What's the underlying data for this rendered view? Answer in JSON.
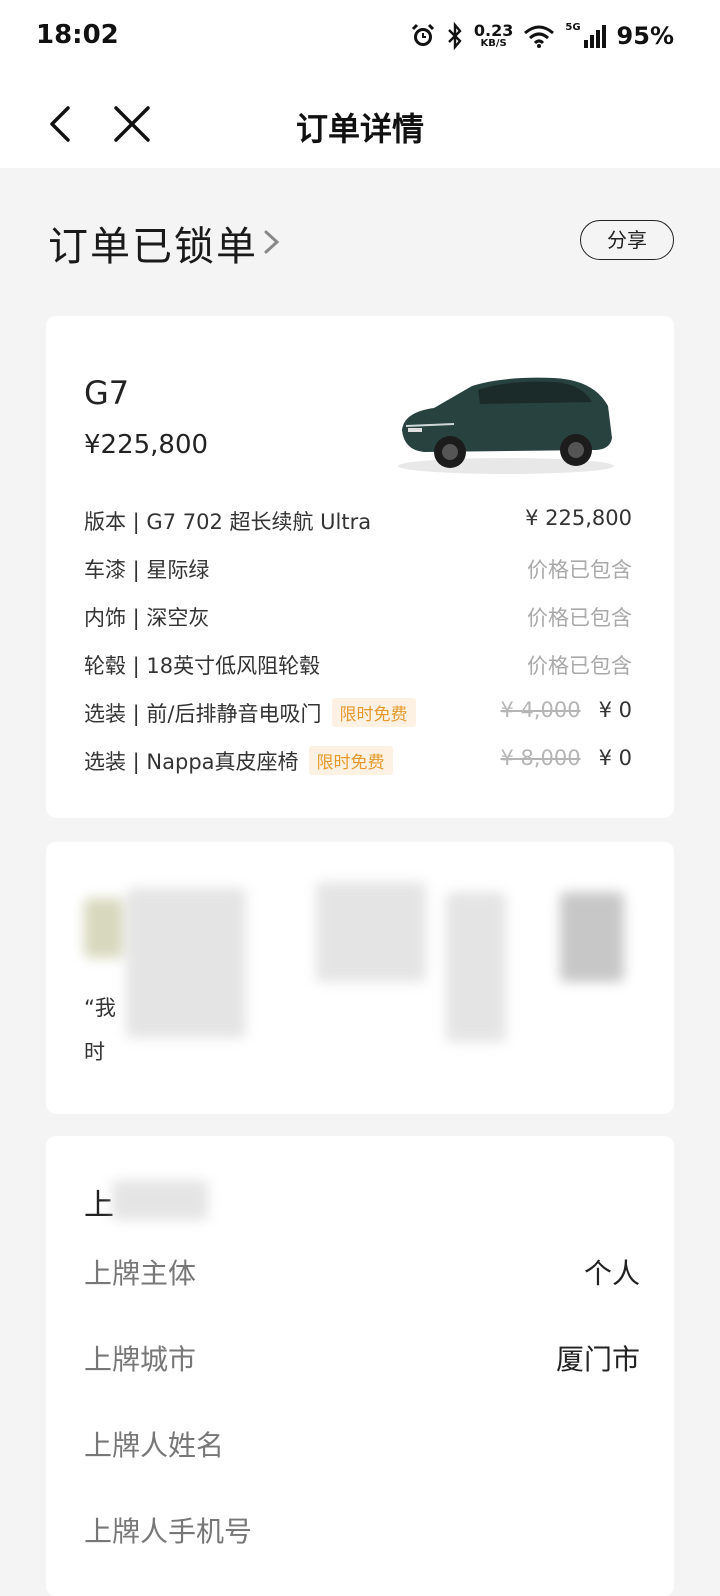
{
  "status_bar": {
    "time": "18:02",
    "net_speed_value": "0.23",
    "net_speed_unit": "KB/S",
    "network": "5G",
    "battery": "95%",
    "icons": [
      "alarm-icon",
      "bluetooth-icon",
      "wifi-icon",
      "signal-icon"
    ]
  },
  "nav": {
    "title": "订单详情",
    "back_icon": "chevron-left-icon",
    "close_icon": "close-icon"
  },
  "order_status": {
    "title": "订单已锁单",
    "share_label": "分享"
  },
  "car": {
    "model": "G7",
    "price": "¥225,800",
    "color_hex": "#27423f"
  },
  "config_rows": [
    {
      "label": "版本 | G7 702 超长续航 Ultra",
      "value": "¥ 225,800"
    },
    {
      "label": "车漆 | 星际绿",
      "value": "价格已包含"
    },
    {
      "label": "内饰 | 深空灰",
      "value": "价格已包含"
    },
    {
      "label": "轮毂 | 18英寸低风阻轮毂",
      "value": "价格已包含"
    },
    {
      "label": "选装 | 前/后排静音电吸门",
      "tag": "限时免费",
      "old_price": "¥ 4,000",
      "value": "¥ 0"
    },
    {
      "label": "选装 | Nappa真皮座椅",
      "tag": "限时免费",
      "old_price": "¥ 8,000",
      "value": "¥ 0"
    }
  ],
  "blurred_card": {
    "line1": "“我",
    "line2": "时"
  },
  "plate_info": {
    "heading": "上",
    "rows": [
      {
        "key": "上牌主体",
        "value": "个人"
      },
      {
        "key": "上牌城市",
        "value": "厦门市"
      },
      {
        "key": "上牌人姓名",
        "value": ""
      },
      {
        "key": "上牌人手机号",
        "value": ""
      }
    ]
  },
  "colors": {
    "background": "#f4f4f4",
    "card": "#ffffff",
    "tag_bg": "#fdf1e3",
    "tag_text": "#e69a2e",
    "muted": "#a9a9a9"
  }
}
